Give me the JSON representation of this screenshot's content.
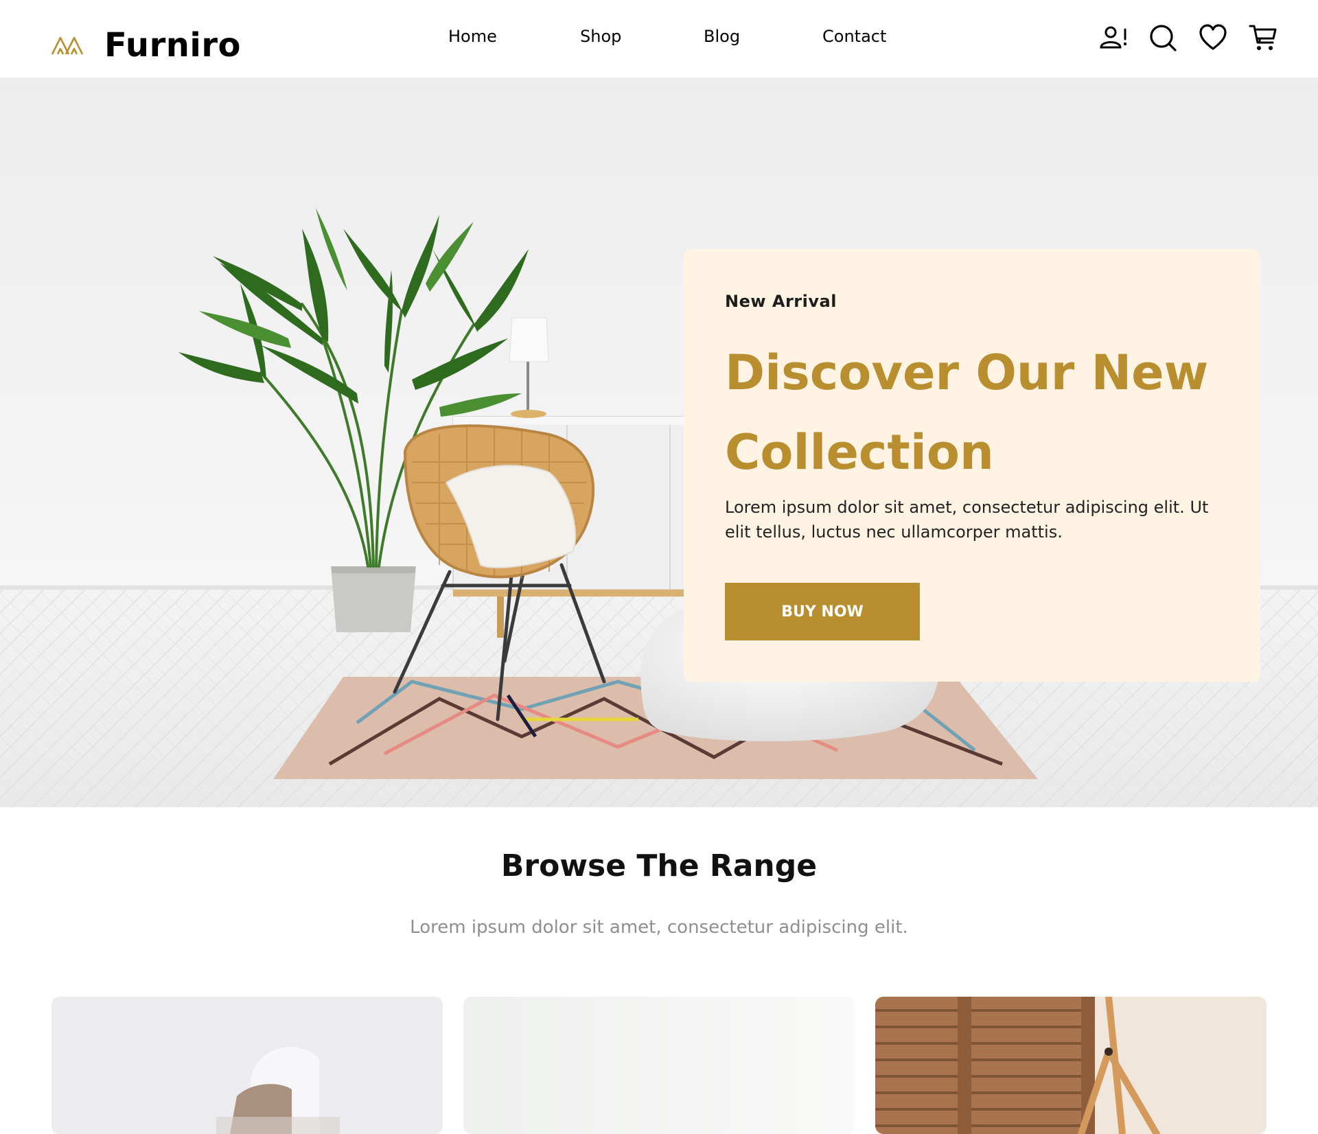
{
  "brand": {
    "name": "Furniro",
    "logo_icon": "furniro-logo-mark",
    "accent_color": "#B88E2F"
  },
  "nav": {
    "items": [
      {
        "label": "Home"
      },
      {
        "label": "Shop"
      },
      {
        "label": "Blog"
      },
      {
        "label": "Contact"
      }
    ]
  },
  "header_icons": [
    {
      "name": "account-alert-icon"
    },
    {
      "name": "search-icon"
    },
    {
      "name": "heart-icon"
    },
    {
      "name": "cart-icon"
    }
  ],
  "hero": {
    "card_background": "#FFF3E3",
    "eyebrow": "New Arrival",
    "title": "Discover Our New Collection",
    "body": "Lorem ipsum dolor sit amet, consectetur adipiscing elit. Ut elit tellus, luctus nec ullamcorper mattis.",
    "cta_label": "BUY NOW"
  },
  "browse": {
    "title": "Browse The Range",
    "subtitle": "Lorem ipsum dolor sit amet, consectetur adipiscing elit."
  }
}
